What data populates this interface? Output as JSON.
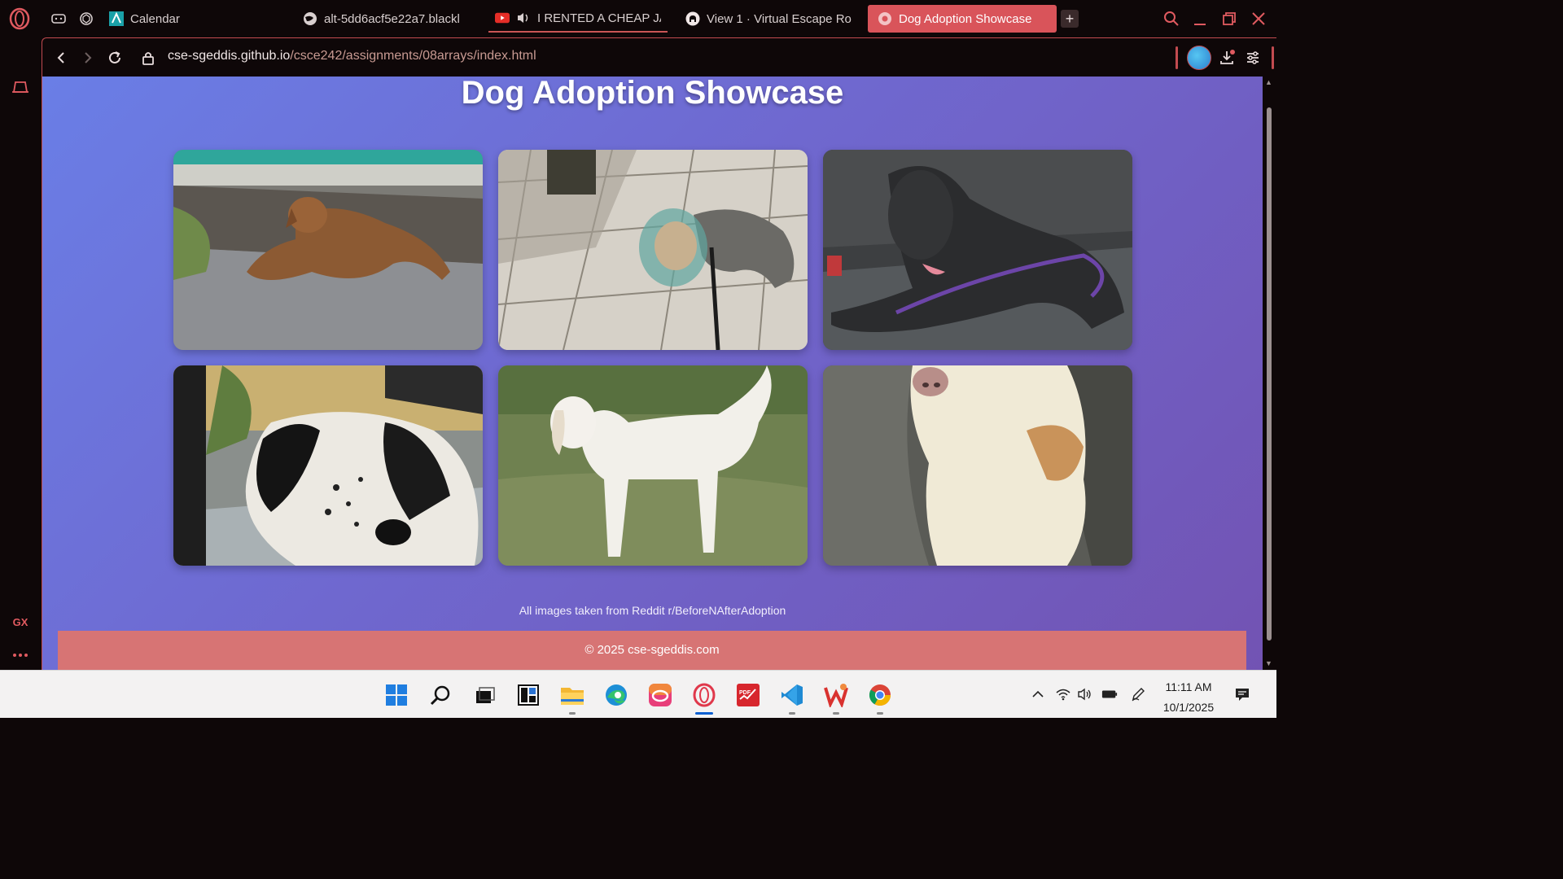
{
  "browser": {
    "tabs": [
      {
        "label": "Calendar",
        "favicon": "calendar-app-icon"
      },
      {
        "label": "alt-5dd6acf5e22a7.blackl",
        "favicon": "globe-icon"
      },
      {
        "label": "I RENTED A CHEAP JA",
        "favicon": "youtube-icon",
        "audio": "speaker-icon"
      },
      {
        "label": "View 1 · Virtual Escape Ro",
        "favicon": "github-icon"
      },
      {
        "label": "Dog Adoption Showcase",
        "favicon": "opera-tab-icon",
        "active": true
      }
    ],
    "url": {
      "host": "cse-sgeddis.github.io",
      "path": "/csce242/assignments/08arrays/index.html"
    },
    "sidebar": {
      "gx_label": "GX"
    }
  },
  "page": {
    "title": "Dog Adoption Showcase",
    "images": [
      {
        "alt": "Brown dog lying on pavement"
      },
      {
        "alt": "Small terrier wearing a cone on tile floor"
      },
      {
        "alt": "Gray dog lying on car seat"
      },
      {
        "alt": "Black and white spotted dog"
      },
      {
        "alt": "White dog standing on grass"
      },
      {
        "alt": "Cream-colored dog close-up"
      }
    ],
    "credit": "All images taken from Reddit r/BeforeNAfterAdoption",
    "footer": "© 2025 cse-sgeddis.com"
  },
  "taskbar": {
    "time": "11:11 AM",
    "date": "10/1/2025",
    "apps": [
      "start-icon",
      "search-icon",
      "task-view-icon",
      "widgets-icon",
      "file-explorer-icon",
      "edge-icon",
      "creative-cloud-icon",
      "opera-gx-icon",
      "pdf-icon",
      "vscode-icon",
      "wps-icon",
      "chrome-icon"
    ]
  },
  "colors": {
    "accent": "#d9545a",
    "page_gradient_start": "#6a7ee6",
    "page_gradient_end": "#7253b3",
    "footer": "#d77474"
  }
}
